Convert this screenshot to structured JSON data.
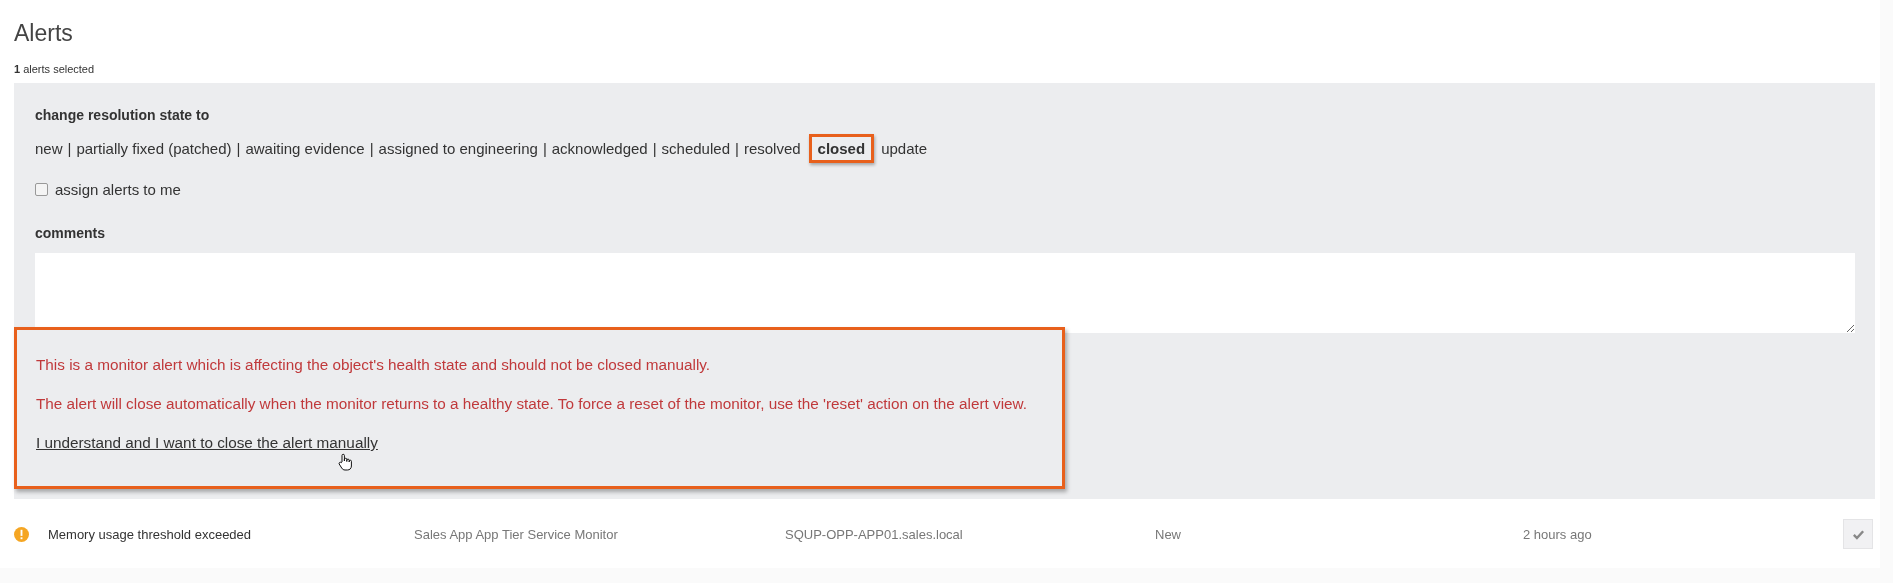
{
  "page": {
    "title": "Alerts",
    "selection_count": "1",
    "selection_label": "alerts selected"
  },
  "resolution": {
    "heading": "change resolution state to",
    "separator": "|",
    "states": [
      {
        "label": "new",
        "selected": false
      },
      {
        "label": "partially fixed (patched)",
        "selected": false
      },
      {
        "label": "awaiting evidence",
        "selected": false
      },
      {
        "label": "assigned to engineering",
        "selected": false
      },
      {
        "label": "acknowledged",
        "selected": false
      },
      {
        "label": "scheduled",
        "selected": false
      },
      {
        "label": "resolved",
        "selected": false
      },
      {
        "label": "closed",
        "selected": true
      }
    ],
    "update_link": "update"
  },
  "assign_to_me": {
    "label": "assign alerts to me",
    "checked": false
  },
  "comments": {
    "label": "comments"
  },
  "warning": {
    "messages": [
      "This is a monitor alert which is affecting the object's health state and should not be closed manually.",
      "The alert will close automatically when the monitor returns to a healthy state. To force a reset of the monitor, use the 'reset' action on the alert view."
    ],
    "confirm_link": "I understand and I want to close the alert manually"
  },
  "alerts": [
    {
      "name": "Memory usage threshold exceeded",
      "monitor": "Sales App App Tier Service Monitor",
      "source": "SQUP-OPP-APP01.sales.local",
      "state": "New",
      "age": "2 hours ago",
      "color": "#f5a623",
      "checked": true
    }
  ]
}
